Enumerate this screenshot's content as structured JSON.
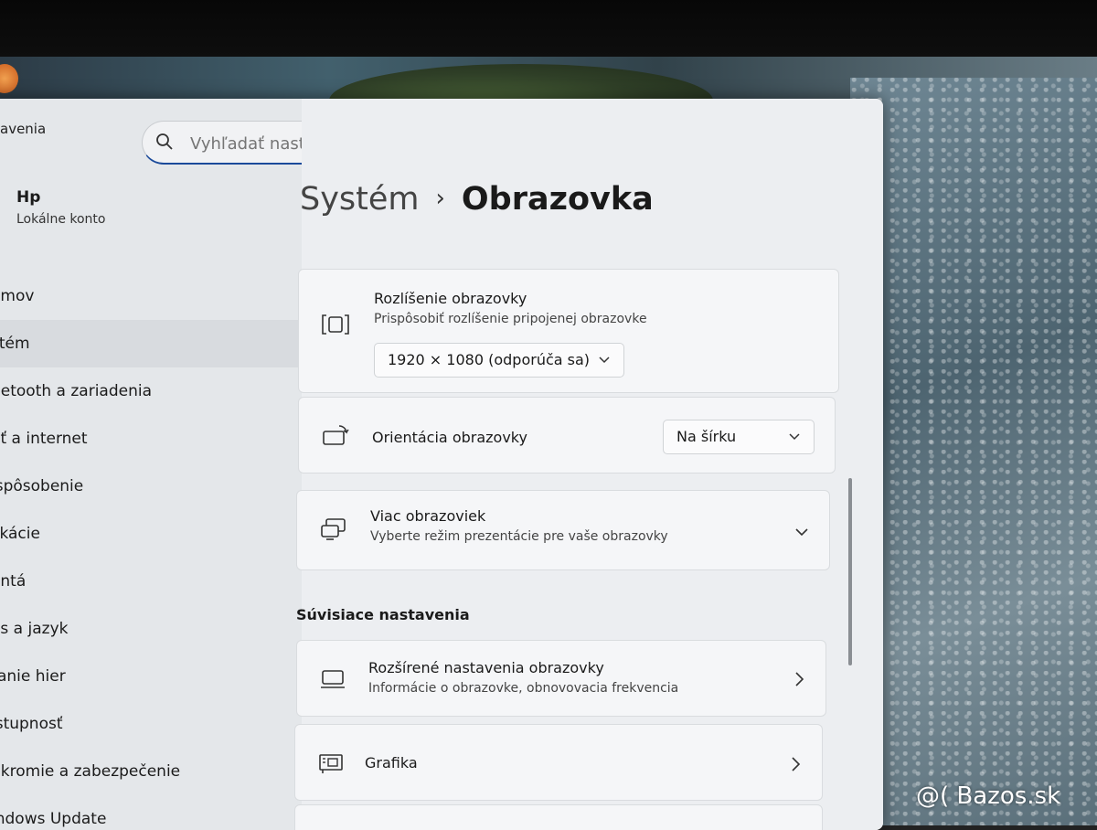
{
  "app": {
    "title": "avenia"
  },
  "search": {
    "placeholder": "Vyhľadať nastavenie"
  },
  "user": {
    "name": "Hp",
    "account": "Lokálne konto"
  },
  "sidebar": {
    "items": [
      {
        "label": "omov"
      },
      {
        "label": "stém"
      },
      {
        "label": "uetooth a zariadenia"
      },
      {
        "label": "eť a internet"
      },
      {
        "label": "ispôsobenie"
      },
      {
        "label": "likácie"
      },
      {
        "label": "ontá"
      },
      {
        "label": "as a jazyk"
      },
      {
        "label": "ranie hier"
      },
      {
        "label": "ístupnosť"
      },
      {
        "label": "ūkromie a zabezpečenie"
      },
      {
        "label": "indows Update"
      }
    ],
    "active_index": 1
  },
  "breadcrumb": {
    "parent": "Systém",
    "separator": "›",
    "current": "Obrazovka"
  },
  "display": {
    "resolution": {
      "title": "Rozlíšenie obrazovky",
      "subtitle": "Prispôsobiť rozlíšenie pripojenej obrazovke",
      "value": "1920 × 1080 (odporúča sa)"
    },
    "orientation": {
      "title": "Orientácia obrazovky",
      "value": "Na šírku"
    },
    "multiple": {
      "title": "Viac obrazoviek",
      "subtitle": "Vyberte režim prezentácie pre vaše obrazovky"
    }
  },
  "related": {
    "title": "Súvisiace nastavenia",
    "advanced": {
      "title": "Rozšírené nastavenia obrazovky",
      "subtitle": "Informácie o obrazovke, obnovovacia frekvencia"
    },
    "graphics": {
      "title": "Grafika"
    }
  },
  "watermark": {
    "text": "@( Bazos.sk"
  },
  "colors": {
    "accent": "#1a4a9a",
    "window_bg": "#eceef1",
    "card_bg": "#f5f6f8"
  }
}
